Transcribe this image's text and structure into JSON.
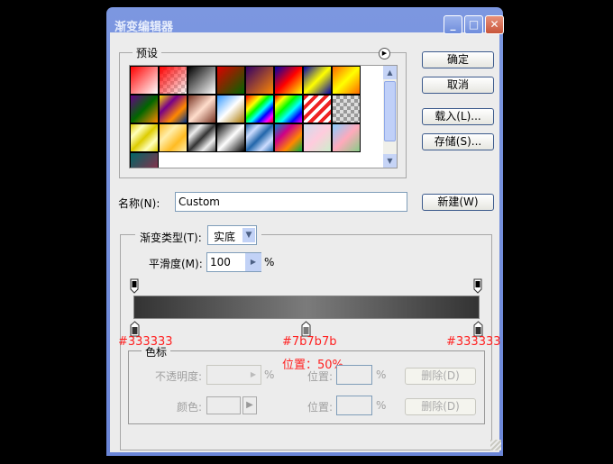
{
  "window": {
    "title": "渐变编辑器",
    "minimize": "_",
    "maximize": "□",
    "close": "✕"
  },
  "presets": {
    "label": "预设",
    "menu_icon": "▶",
    "scroll_up": "▲",
    "scroll_down": "▼"
  },
  "buttons": {
    "ok": "确定",
    "cancel": "取消",
    "load": "载入(L)...",
    "save": "存储(S)...",
    "new": "新建(W)"
  },
  "name": {
    "label": "名称(N):",
    "value": "Custom"
  },
  "gradient": {
    "type_label": "渐变类型(T):",
    "type_value": "实底",
    "smooth_label": "平滑度(M):",
    "smooth_value": "100",
    "smooth_unit": "%",
    "colors": [
      "#333333",
      "#7b7b7b",
      "#333333"
    ]
  },
  "annotations": {
    "left": "#333333",
    "mid": "#7b7b7b",
    "right": "#333333",
    "position": "位置：50%"
  },
  "stops": {
    "label": "色标",
    "opacity_label": "不透明度:",
    "opacity_unit": "%",
    "position_label": "位置:",
    "position_unit": "%",
    "delete": "删除(D)",
    "color_label": "颜色:"
  }
}
